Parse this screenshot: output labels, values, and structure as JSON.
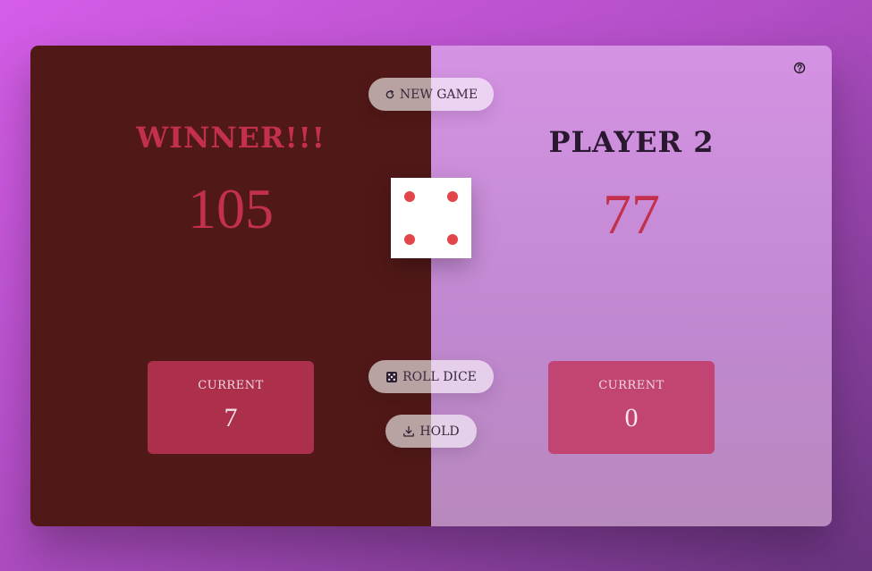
{
  "players": [
    {
      "name": "WINNER!!!",
      "score": "105",
      "current_label": "CURRENT",
      "current_score": "7"
    },
    {
      "name": "PLAYER 2",
      "score": "77",
      "current_label": "CURRENT",
      "current_score": "0"
    }
  ],
  "buttons": {
    "new_game": "NEW GAME",
    "roll_dice": "ROLL DICE",
    "hold": "HOLD"
  },
  "dice": {
    "value": 4
  },
  "icons": {
    "new_game": "refresh-icon",
    "roll_dice": "dice-icon",
    "hold": "download-icon",
    "help": "help-icon"
  },
  "colors": {
    "winner_panel": "#511818",
    "accent": "#c3304e",
    "dice_pip": "#e0464a"
  }
}
